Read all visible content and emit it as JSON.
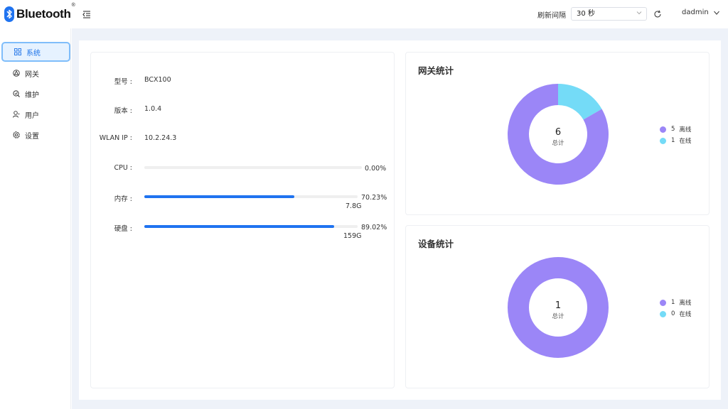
{
  "header": {
    "logo_text": "Bluetooth",
    "logo_mark": "®",
    "refresh_label": "刷新间隔",
    "refresh_value": "30 秒",
    "user": "dadmin",
    "brand_color": "#1f73f0"
  },
  "sidebar": {
    "items": [
      {
        "label": "系统",
        "icon": "grid-icon",
        "active": true
      },
      {
        "label": "网关",
        "icon": "gateway-icon",
        "active": false
      },
      {
        "label": "维护",
        "icon": "wrench-icon",
        "active": false
      },
      {
        "label": "用户",
        "icon": "user-icon",
        "active": false
      },
      {
        "label": "设置",
        "icon": "gear-icon",
        "active": false
      }
    ]
  },
  "system_info": {
    "model_label": "型号 :",
    "model_value": "BCX100",
    "version_label": "版本 :",
    "version_value": "1.0.4",
    "ip_label": "WLAN IP :",
    "ip_value": "10.2.24.3",
    "cpu_label": "CPU :",
    "cpu_percent": 0.0,
    "cpu_text": "0.00%",
    "mem_label": "内存 :",
    "mem_percent": 70.23,
    "mem_text": "70.23%",
    "mem_size": "7.8G",
    "disk_label": "硬盘 :",
    "disk_percent": 89.02,
    "disk_text": "89.02%",
    "disk_size": "159G"
  },
  "gateway_stats": {
    "title": "网关统计",
    "total": "6",
    "total_label": "总计",
    "offline_count": "5",
    "offline_label": "离线",
    "online_count": "1",
    "online_label": "在线",
    "offline_color": "#9b86f7",
    "online_color": "#74dbf7"
  },
  "device_stats": {
    "title": "设备统计",
    "total": "1",
    "total_label": "总计",
    "offline_count": "1",
    "offline_label": "离线",
    "online_count": "0",
    "online_label": "在线",
    "offline_color": "#9b86f7",
    "online_color": "#74dbf7"
  }
}
